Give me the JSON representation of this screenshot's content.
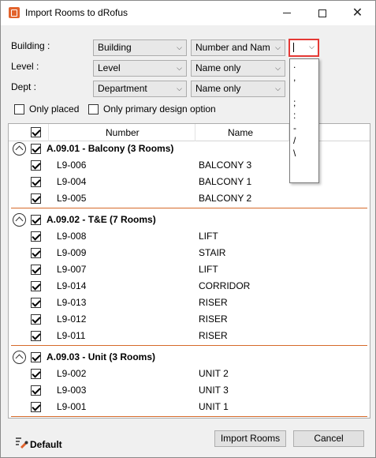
{
  "window": {
    "title": "Import Rooms to dRofus"
  },
  "filters": {
    "building_label": "Building :",
    "level_label": "Level :",
    "dept_label": "Dept :",
    "building_value": "Building",
    "building_format": "Number and Nam",
    "level_value": "Level",
    "level_format": "Name only",
    "dept_value": "Department",
    "dept_format": "Name only",
    "separator_value": "|"
  },
  "separator_options": [
    ".",
    ",",
    "",
    ";",
    ":",
    "-",
    "/",
    "\\"
  ],
  "options": {
    "only_placed": "Only placed",
    "only_primary": "Only primary design option"
  },
  "grid": {
    "columns": {
      "number": "Number",
      "name": "Name"
    },
    "groups": [
      {
        "title": "A.09.01 - Balcony (3 Rooms)",
        "rows": [
          {
            "number": "L9-006",
            "name": "BALCONY 3"
          },
          {
            "number": "L9-004",
            "name": "BALCONY 1"
          },
          {
            "number": "L9-005",
            "name": "BALCONY 2"
          }
        ]
      },
      {
        "title": "A.09.02 - T&E (7 Rooms)",
        "rows": [
          {
            "number": "L9-008",
            "name": "LIFT"
          },
          {
            "number": "L9-009",
            "name": "STAIR"
          },
          {
            "number": "L9-007",
            "name": "LIFT"
          },
          {
            "number": "L9-014",
            "name": "CORRIDOR"
          },
          {
            "number": "L9-013",
            "name": "RISER"
          },
          {
            "number": "L9-012",
            "name": "RISER"
          },
          {
            "number": "L9-011",
            "name": "RISER"
          }
        ]
      },
      {
        "title": "A.09.03 - Unit (3 Rooms)",
        "rows": [
          {
            "number": "L9-002",
            "name": "UNIT 2"
          },
          {
            "number": "L9-003",
            "name": "UNIT 3"
          },
          {
            "number": "L9-001",
            "name": "UNIT 1"
          }
        ]
      }
    ]
  },
  "footer": {
    "default_label": "Default",
    "import_button": "Import Rooms",
    "cancel_button": "Cancel"
  },
  "colors": {
    "accent_line": "#d66a2a",
    "highlight_border": "#e53935",
    "app_icon": "#e2632c"
  }
}
